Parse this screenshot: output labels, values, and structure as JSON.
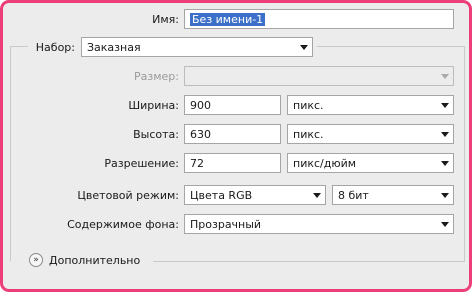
{
  "name": {
    "label": "Имя:",
    "value": "Без имени-1"
  },
  "preset": {
    "label": "Набор:",
    "value": "Заказная"
  },
  "size": {
    "label": "Размер:",
    "value": ""
  },
  "width": {
    "label": "Ширина:",
    "value": "900",
    "unit": "пикс."
  },
  "height": {
    "label": "Высота:",
    "value": "630",
    "unit": "пикс."
  },
  "resolution": {
    "label": "Разрешение:",
    "value": "72",
    "unit": "пикс/дюйм"
  },
  "color_mode": {
    "label": "Цветовой режим:",
    "value": "Цвета RGB",
    "depth": "8 бит"
  },
  "background": {
    "label": "Содержимое фона:",
    "value": "Прозрачный"
  },
  "advanced": {
    "label": "Дополнительно"
  },
  "icons": {
    "expand": "double-chevron-down-icon",
    "dropdown": "chevron-down-icon"
  },
  "colors": {
    "frame_border": "#ec3f7a",
    "selection": "#3c6fc8",
    "panel": "#ececec"
  }
}
